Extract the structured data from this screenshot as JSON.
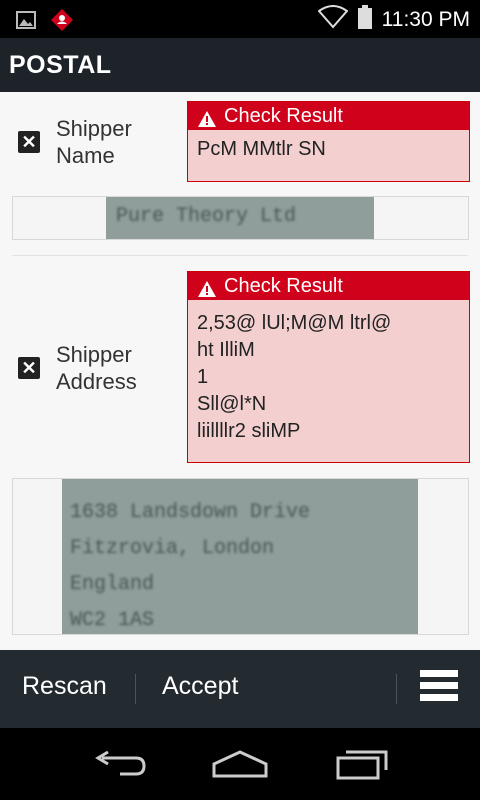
{
  "status_bar": {
    "time": "11:30 PM",
    "icons": [
      "image-icon",
      "app-notification-icon",
      "wifi-icon",
      "battery-icon"
    ]
  },
  "app_bar": {
    "title": "POSTAL"
  },
  "fields": [
    {
      "label_line1": "Shipper",
      "label_line2": "Name",
      "checkbox": "✕",
      "result_header": "Check Result",
      "result_lines": [
        "PcM MMtlr SN"
      ],
      "scan_lines": [
        "Pure Theory Ltd"
      ]
    },
    {
      "label_line1": "Shipper",
      "label_line2": "Address",
      "checkbox": "✕",
      "result_header": "Check Result",
      "result_lines": [
        "2,53@ lUl;M@M ltrl@",
        "ht IlliM",
        "1",
        "Sll@l*N",
        "liillllr2 sliMP"
      ],
      "scan_lines": [
        "1638 Landsdown Drive",
        "Fitzrovia, London",
        "England",
        "WC2 1AS"
      ]
    }
  ],
  "bottom_bar": {
    "rescan_label": "Rescan",
    "accept_label": "Accept",
    "menu_icon": "hamburger-menu-icon"
  },
  "nav_bar": {
    "icons": [
      "back-icon",
      "home-icon",
      "recent-apps-icon"
    ]
  }
}
